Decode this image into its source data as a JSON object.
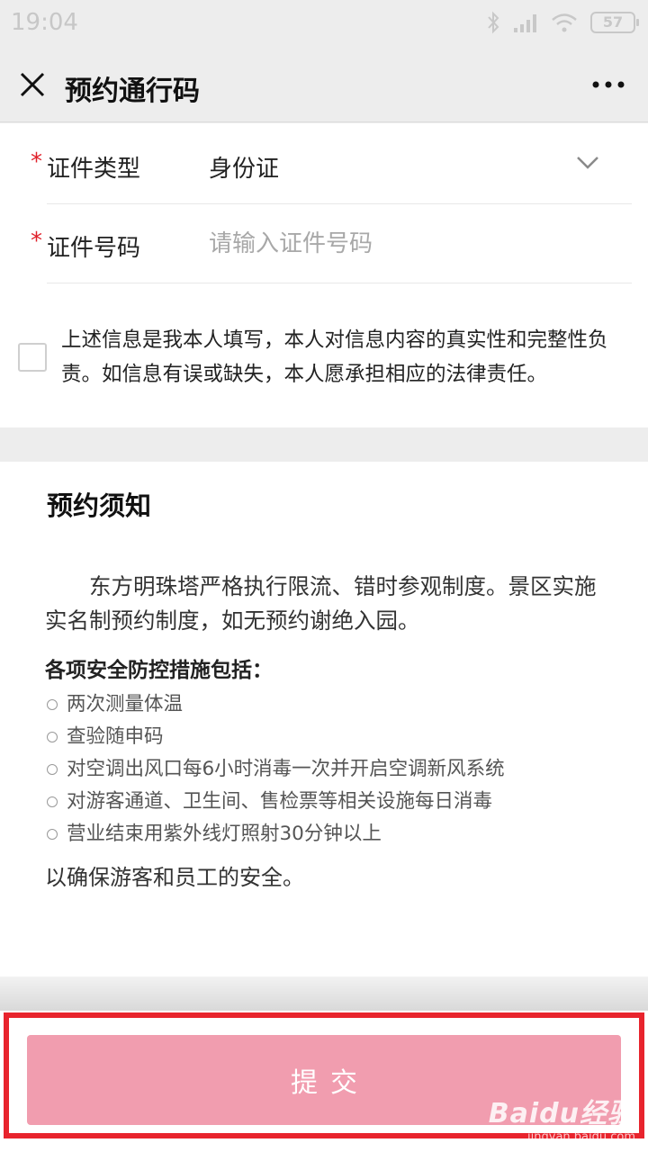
{
  "status_bar": {
    "time": "19:04",
    "battery": "57",
    "icons": [
      "bluetooth-icon",
      "signal-icon",
      "wifi-icon",
      "battery-icon"
    ]
  },
  "header": {
    "title": "预约通行码",
    "close_icon": "close-icon",
    "more_icon": "more-icon"
  },
  "form": {
    "id_type": {
      "required_mark": "*",
      "label": "证件类型",
      "value": "身份证"
    },
    "id_number": {
      "required_mark": "*",
      "label": "证件号码",
      "value": "",
      "placeholder": "请输入证件号码"
    },
    "agreement": {
      "checked": false,
      "text": "上述信息是我本人填写，本人对信息内容的真实性和完整性负责。如信息有误或缺失，本人愿承担相应的法律责任。"
    }
  },
  "notice": {
    "title": "预约须知",
    "paragraph": "东方明珠塔严格执行限流、错时参观制度。景区实施实名制预约制度，如无预约谢绝入园。",
    "measures_title": "各项安全防控措施包括：",
    "measures": [
      "两次测量体温",
      "查验随申码",
      "对空调出风口每6小时消毒一次并开启空调新风系统",
      "对游客通道、卫生间、售检票等相关设施每日消毒",
      "营业结束用紫外线灯照射30分钟以上"
    ],
    "closing": "以确保游客和员工的安全。"
  },
  "submit": {
    "label": "提交",
    "color": "#f19daf"
  },
  "watermark": {
    "brand": "Baidu经验",
    "url": "jingyan.baidu.com"
  },
  "colors": {
    "required": "#e0202a",
    "highlight_frame": "#e8242d",
    "background": "#ededed"
  }
}
